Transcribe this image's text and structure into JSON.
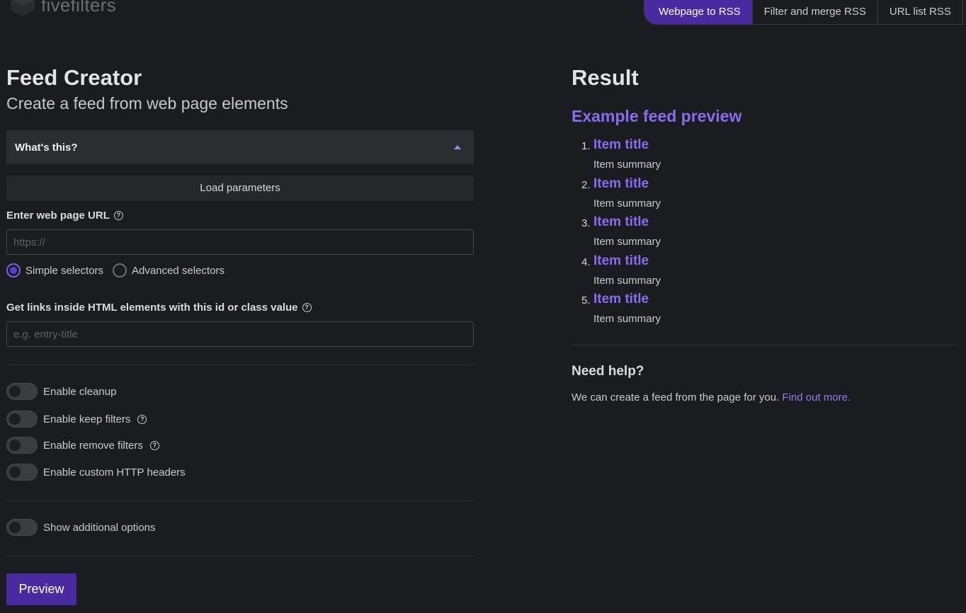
{
  "header": {
    "logo_text": "fivefilters",
    "tabs": [
      {
        "label": "Webpage to RSS",
        "active": true
      },
      {
        "label": "Filter and merge RSS",
        "active": false
      },
      {
        "label": "URL list RSS",
        "active": false
      }
    ]
  },
  "form": {
    "title": "Feed Creator",
    "subtitle": "Create a feed from web page elements",
    "accordion_label": "What's this?",
    "load_button": "Load parameters",
    "url_label": "Enter web page URL",
    "url_placeholder": "https://",
    "selector_modes": [
      {
        "label": "Simple selectors",
        "checked": true
      },
      {
        "label": "Advanced selectors",
        "checked": false
      }
    ],
    "links_label": "Get links inside HTML elements with this id or class value",
    "links_placeholder": "e.g. entry-title",
    "toggles": [
      {
        "label": "Enable cleanup",
        "on": false
      },
      {
        "label": "Enable keep filters",
        "on": false
      },
      {
        "label": "Enable remove filters",
        "on": false
      },
      {
        "label": "Enable custom HTTP headers",
        "on": false
      }
    ],
    "additional_toggle": {
      "label": "Show additional options",
      "on": false
    },
    "preview_button": "Preview",
    "help_glyph": "?"
  },
  "result": {
    "title": "Result",
    "preview_heading": "Example feed preview",
    "items": [
      {
        "num": "1.",
        "title": "Item title",
        "summary": "Item summary"
      },
      {
        "num": "2.",
        "title": "Item title",
        "summary": "Item summary"
      },
      {
        "num": "3.",
        "title": "Item title",
        "summary": "Item summary"
      },
      {
        "num": "4.",
        "title": "Item title",
        "summary": "Item summary"
      },
      {
        "num": "5.",
        "title": "Item title",
        "summary": "Item summary"
      }
    ],
    "help_title": "Need help?",
    "help_text": "We can create a feed from the page for you.",
    "help_link": "Find out more."
  },
  "colors": {
    "accent": "#4a2aa0",
    "link": "#8b6cf0",
    "background": "#1b1c1f"
  }
}
